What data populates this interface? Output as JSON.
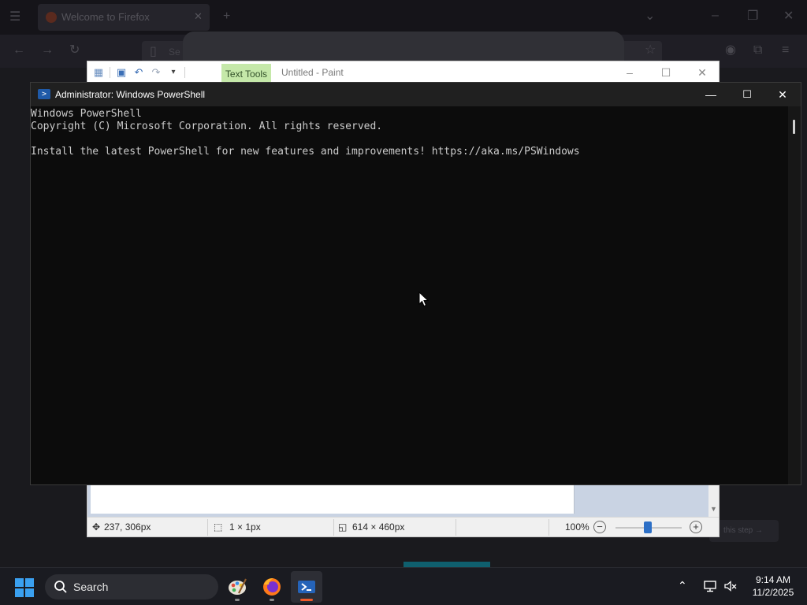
{
  "firefox": {
    "tab_title": "Welcome to Firefox",
    "url_hint": "Se",
    "step_button": "this step →"
  },
  "paint": {
    "title": "Untitled - Paint",
    "context_tab": "Text Tools",
    "status": {
      "cursor_position": "237, 306px",
      "selection_size": "1 × 1px",
      "canvas_size": "614 × 460px",
      "zoom": "100%"
    },
    "zoom_level": 1.0
  },
  "powershell": {
    "title": "Administrator: Windows PowerShell",
    "lines": [
      "Windows PowerShell",
      "Copyright (C) Microsoft Corporation. All rights reserved.",
      "",
      "Install the latest PowerShell for new features and improvements! https://aka.ms/PSWindows"
    ]
  },
  "taskbar": {
    "search_placeholder": "Search",
    "apps": [
      "paint-app-icon",
      "firefox-app-icon",
      "powershell-app-icon"
    ],
    "clock_time": "9:14 AM",
    "clock_date": "11/2/2025"
  },
  "colors": {
    "console_bg": "#0c0c0c",
    "console_text": "#cccccc",
    "taskbar_bg": "#1a1b21",
    "accent": "#2c6fc6",
    "active_indicator": "#f05a2a"
  }
}
